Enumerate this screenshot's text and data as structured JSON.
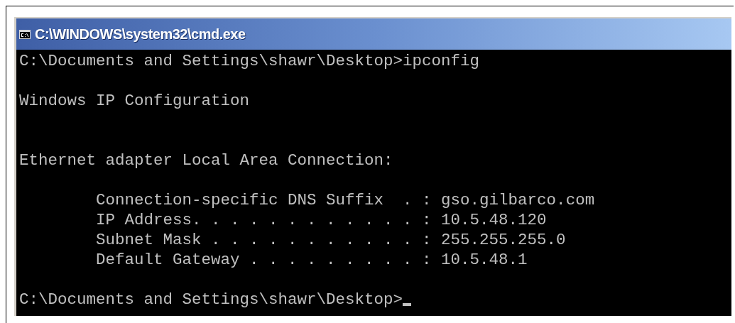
{
  "window": {
    "title": "C:\\WINDOWS\\system32\\cmd.exe"
  },
  "console": {
    "cursor_visible": true,
    "lines": [
      {
        "kind": "text",
        "text": "C:\\Documents and Settings\\shawr\\Desktop>ipconfig"
      },
      {
        "kind": "blank"
      },
      {
        "kind": "text",
        "text": "Windows IP Configuration"
      },
      {
        "kind": "blank"
      },
      {
        "kind": "blank"
      },
      {
        "kind": "text",
        "text": "Ethernet adapter Local Area Connection:"
      },
      {
        "kind": "blank"
      },
      {
        "kind": "text",
        "text": "        Connection-specific DNS Suffix  . : gso.gilbarco.com"
      },
      {
        "kind": "text",
        "text": "        IP Address. . . . . . . . . . . . : 10.5.48.120"
      },
      {
        "kind": "text",
        "text": "        Subnet Mask . . . . . . . . . . . : 255.255.255.0"
      },
      {
        "kind": "text",
        "text": "        Default Gateway . . . . . . . . . : 10.5.48.1"
      },
      {
        "kind": "blank"
      },
      {
        "kind": "prompt",
        "text": "C:\\Documents and Settings\\shawr\\Desktop>"
      }
    ]
  }
}
